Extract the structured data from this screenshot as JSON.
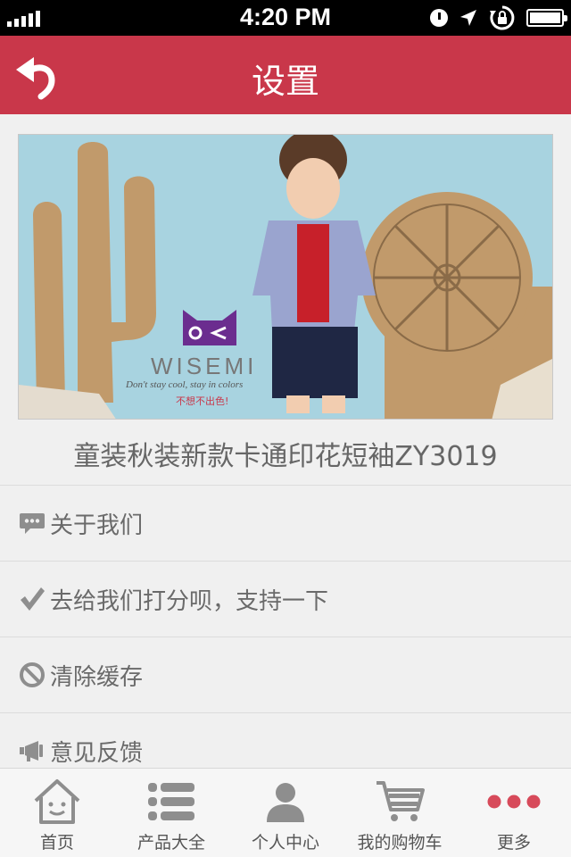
{
  "status_bar": {
    "time": "4:20 PM",
    "icons": [
      "signal-bars-icon",
      "alarm-clock-icon",
      "location-arrow-icon",
      "rotation-lock-icon",
      "battery-icon"
    ]
  },
  "header": {
    "title": "设置",
    "back_icon": "back-arrow-icon"
  },
  "banner": {
    "brand": "WISEMI",
    "slogan": "Don't stay cool, stay in colors",
    "slogan_cn": "不想不出色!"
  },
  "product": {
    "name": "童装秋装新款卡通印花短袖ZY3019"
  },
  "menu": {
    "items": [
      {
        "label": "关于我们",
        "icon": "chat-bubble-icon"
      },
      {
        "label": "去给我们打分呗，支持一下",
        "icon": "checkmark-icon"
      },
      {
        "label": "清除缓存",
        "icon": "no-entry-icon"
      },
      {
        "label": "意见反馈",
        "icon": "megaphone-icon"
      }
    ]
  },
  "tabbar": {
    "items": [
      {
        "label": "首页",
        "icon": "home-icon"
      },
      {
        "label": "产品大全",
        "icon": "list-icon"
      },
      {
        "label": "个人中心",
        "icon": "user-icon"
      },
      {
        "label": "我的购物车",
        "icon": "cart-icon"
      },
      {
        "label": "更多",
        "icon": "more-dots-icon"
      }
    ],
    "active_index": 4
  },
  "colors": {
    "accent": "#c9374a",
    "background": "#f0f0f0",
    "text_muted": "#6a6a6a"
  }
}
